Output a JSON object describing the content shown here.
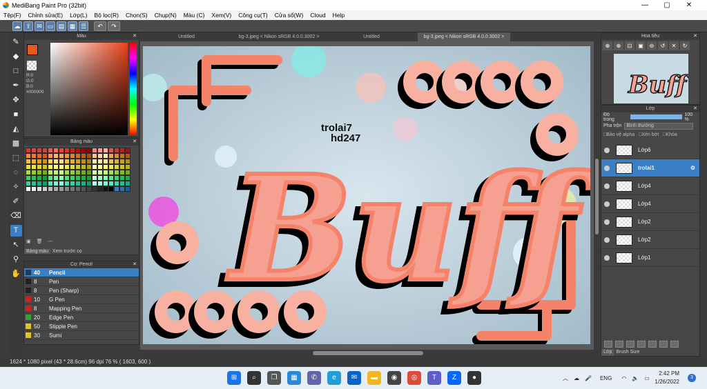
{
  "window": {
    "title": "MediBang Paint Pro (32bit)",
    "minimize": "—",
    "maximize": "▢",
    "close": "✕"
  },
  "menu": [
    "Tệp(F)",
    "Chỉnh sửa(E)",
    "Lớp(L)",
    "Bộ lọc(R)",
    "Chọn(S)",
    "Chụp(N)",
    "Màu (C)",
    "Xem(V)",
    "Công cụ(T)",
    "Cửa sổ(W)",
    "Cloud",
    "Help"
  ],
  "color_panel": {
    "title": "Màu",
    "rgb": "R:0\nG:0\nB:0",
    "hex": "#000000",
    "primary": "#e85a1a"
  },
  "swatch_panel": {
    "title": "Bảng màu",
    "tabs": [
      "Bảng màu",
      "Xem trước cọ"
    ],
    "more": "---"
  },
  "brush_panel": {
    "title": "Cọ: Pencil",
    "brushes": [
      {
        "size": "40",
        "name": "Pencil",
        "color": "#1f3c5a",
        "selected": true
      },
      {
        "size": "8",
        "name": "Pen",
        "color": "#222222"
      },
      {
        "size": "8",
        "name": "Pen (Sharp)",
        "color": "#222222"
      },
      {
        "size": "10",
        "name": "G Pen",
        "color": "#d21f1f"
      },
      {
        "size": "8",
        "name": "Mapping Pen",
        "color": "#d21f1f"
      },
      {
        "size": "20",
        "name": "Edge Pen",
        "color": "#2fa52f"
      },
      {
        "size": "50",
        "name": "Stipple Pen",
        "color": "#e5c420"
      },
      {
        "size": "30",
        "name": "Sumi",
        "color": "#e5c420"
      }
    ]
  },
  "tabs": [
    "Untitled",
    "bg-3.jpeg < Nikon sRGB 4.0.0.3002 >",
    "Untitled",
    "bg-3.jpeg < Nikon sRGB 4.0.0.3002 >"
  ],
  "artwork": {
    "line1": "trolai7",
    "line2": "hd247",
    "word": "Buff",
    "accent": "#f5836a"
  },
  "navigator": {
    "title": "Hoa tiêu"
  },
  "layer_panel": {
    "title": "Lớp",
    "opacity_label": "Độ trong",
    "opacity_value": "100 %",
    "blend_label": "Pha trộn",
    "blend_value": "Bình thường",
    "protect_alpha": "Bảo vệ alpha",
    "clipping": "Xén bớt",
    "lock": "Khóa",
    "layers": [
      {
        "name": "Lớp6",
        "selected": false
      },
      {
        "name": "trolai1",
        "selected": true
      },
      {
        "name": "Lớp4",
        "selected": false
      },
      {
        "name": "Lớp4",
        "selected": false
      },
      {
        "name": "Lớp2",
        "selected": false
      },
      {
        "name": "Lớp2",
        "selected": false
      },
      {
        "name": "Lớp1",
        "selected": false
      }
    ],
    "tabs": [
      "Lớp",
      "Brush Size"
    ]
  },
  "status": "1624 * 1080 pixel   (43 * 28.6cm)   96 dpi   76 %   ( 1603, 600 )",
  "taskbar": {
    "lang": "ENG",
    "time": "2:42 PM",
    "date": "1/26/2022",
    "notif_count": "3",
    "apps": [
      {
        "name": "windows-start-icon",
        "color": "#1a73e8"
      },
      {
        "name": "search-icon",
        "color": "#333"
      },
      {
        "name": "task-view-icon",
        "color": "#555"
      },
      {
        "name": "widgets-icon",
        "color": "#2b88d8"
      },
      {
        "name": "teams-chat-icon",
        "color": "#6264a7"
      },
      {
        "name": "edge-icon",
        "color": "#1fa0d9"
      },
      {
        "name": "mail-icon",
        "color": "#0a64c8"
      },
      {
        "name": "file-explorer-icon",
        "color": "#f2b824"
      },
      {
        "name": "camera-icon",
        "color": "#444"
      },
      {
        "name": "chrome-icon",
        "color": "#dd4b39"
      },
      {
        "name": "teams-icon",
        "color": "#5b5fc7"
      },
      {
        "name": "zalo-icon",
        "color": "#0a68ff"
      },
      {
        "name": "medibang-icon",
        "color": "#333"
      }
    ]
  }
}
